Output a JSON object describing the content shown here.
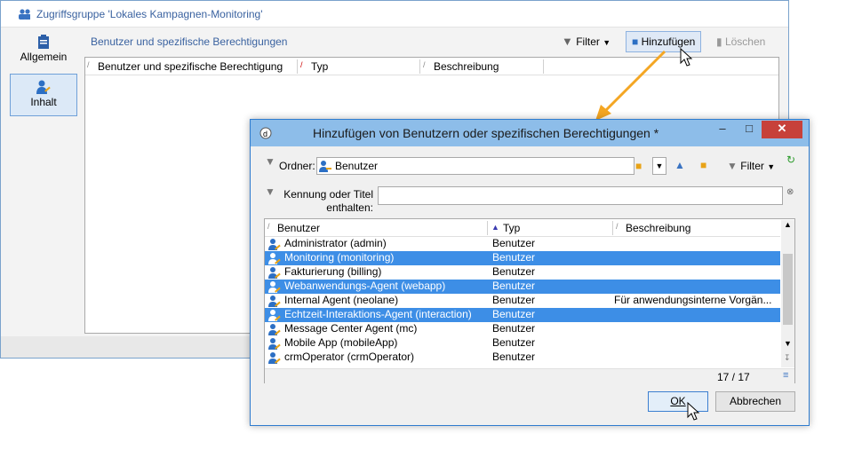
{
  "back_window": {
    "title": "Zugriffsgruppe 'Lokales Kampagnen-Monitoring'",
    "sidebar": {
      "items": [
        {
          "label": "Allgemein"
        },
        {
          "label": "Inhalt"
        }
      ]
    },
    "section_title": "Benutzer und spezifische Berechtigungen",
    "toolbar": {
      "filter": "Filter",
      "add": "Hinzufügen",
      "delete": "Löschen"
    },
    "columns": [
      "Benutzer und spezifische Berechtigung",
      "Typ",
      "Beschreibung"
    ]
  },
  "dialog": {
    "title": "Hinzufügen von Benutzern oder spezifischen Berechtigungen *",
    "folder_label": "Ordner:",
    "folder_value": "Benutzer",
    "filter_label": "Filter",
    "search_label_1": "Kennung oder Titel",
    "search_label_2": "enthalten:",
    "search_value": "",
    "columns": [
      "Benutzer",
      "Typ",
      "Beschreibung"
    ],
    "rows": [
      {
        "name": "Administrator (admin)",
        "type": "Benutzer",
        "desc": "",
        "selected": false
      },
      {
        "name": "Monitoring (monitoring)",
        "type": "Benutzer",
        "desc": "",
        "selected": true
      },
      {
        "name": "Fakturierung (billing)",
        "type": "Benutzer",
        "desc": "",
        "selected": false
      },
      {
        "name": "Webanwendungs-Agent (webapp)",
        "type": "Benutzer",
        "desc": "",
        "selected": true
      },
      {
        "name": "Internal Agent (neolane)",
        "type": "Benutzer",
        "desc": "Für anwendungsinterne Vorgän...",
        "selected": false
      },
      {
        "name": "Echtzeit-Interaktions-Agent (interaction)",
        "type": "Benutzer",
        "desc": "",
        "selected": true
      },
      {
        "name": "Message Center Agent (mc)",
        "type": "Benutzer",
        "desc": "",
        "selected": false
      },
      {
        "name": "Mobile App (mobileApp)",
        "type": "Benutzer",
        "desc": "",
        "selected": false
      },
      {
        "name": "crmOperator (crmOperator)",
        "type": "Benutzer",
        "desc": "",
        "selected": false
      }
    ],
    "count": "17 / 17",
    "ok": "OK",
    "cancel": "Abbrechen"
  },
  "colors": {
    "accent": "#3d8ee6",
    "arrow": "#f4a623",
    "title_bar": "#8dbde9",
    "close": "#c7413a"
  }
}
